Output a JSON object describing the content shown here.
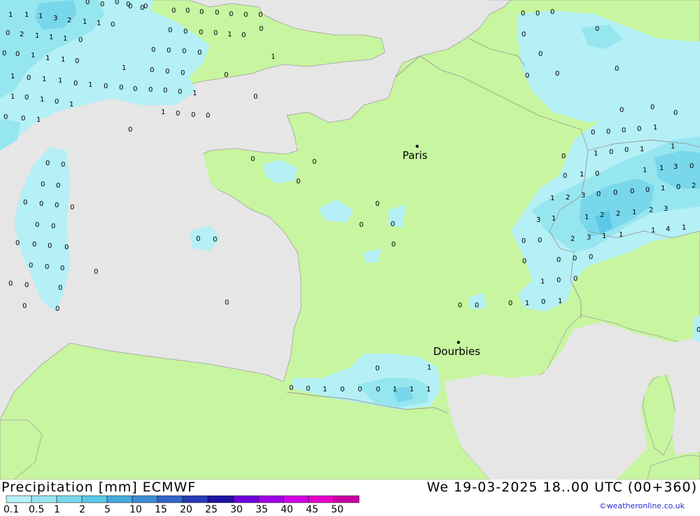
{
  "header": {
    "product": "Precipitation [mm] ECMWF",
    "valid_time": "We 19-03-2025 18..00 UTC (00+360)"
  },
  "credit": "©weatheronline.co.uk",
  "legend": {
    "levels": [
      "0.1",
      "0.5",
      "1",
      "2",
      "5",
      "10",
      "15",
      "20",
      "25",
      "30",
      "35",
      "40",
      "45",
      "50"
    ],
    "colors": [
      "#b4f0f5",
      "#96e6f0",
      "#78d7eb",
      "#5ac8e6",
      "#46aadc",
      "#3c8cd2",
      "#3264c8",
      "#283cb4",
      "#1e14a0",
      "#6e00dc",
      "#a000e6",
      "#d200e6",
      "#e600c8",
      "#c800a0"
    ]
  },
  "cities": [
    {
      "name": "Paris"
    },
    {
      "name": "Dourbies"
    }
  ],
  "colors": {
    "sea": "#e6e6e6",
    "land": "#c8f5a0",
    "precip_light": "#b4f0f5",
    "precip_medium": "#96e6f0",
    "precip_heavy": "#78d7eb",
    "border": "#a0a0a0"
  },
  "precip_values": [
    "1",
    "1",
    "1",
    "3",
    "2",
    "1",
    "1",
    "0",
    "0",
    "0",
    "0",
    "0",
    "0",
    "0",
    "0",
    "0",
    "0",
    "0",
    "0",
    "0",
    "0",
    "0",
    "0",
    "2",
    "1",
    "1",
    "1",
    "0",
    "0",
    "0",
    "0",
    "0",
    "1",
    "0",
    "0",
    "0",
    "0",
    "1",
    "1",
    "1",
    "0",
    "0",
    "0",
    "0",
    "0",
    "1",
    "1",
    "0",
    "1",
    "1",
    "0",
    "1",
    "0",
    "0",
    "0",
    "0",
    "0",
    "0",
    "1",
    "0",
    "1",
    "0",
    "1",
    "0",
    "1",
    "1",
    "0",
    "0",
    "0",
    "0",
    "0",
    "1",
    "1",
    "0",
    "0",
    "0",
    "0",
    "0",
    "0",
    "0",
    "0",
    "0",
    "0",
    "0",
    "0",
    "0",
    "0",
    "0",
    "0",
    "0",
    "0",
    "0",
    "0",
    "0",
    "0",
    "0",
    "0",
    "0",
    "0",
    "0",
    "0",
    "0",
    "0",
    "0",
    "0",
    "0",
    "0",
    "0",
    "0",
    "0",
    "0",
    "0",
    "0",
    "0",
    "0",
    "0",
    "0",
    "0",
    "0",
    "0",
    "0",
    "0",
    "0",
    "0",
    "0",
    "0",
    "0",
    "0",
    "0",
    "0",
    "0",
    "0",
    "0",
    "0",
    "0",
    "0",
    "0",
    "0",
    "0",
    "0",
    "0",
    "0",
    "0",
    "1",
    "0",
    "1",
    "0",
    "0",
    "1",
    "1",
    "0",
    "1",
    "0",
    "1",
    "1",
    "0",
    "1",
    "2",
    "3",
    "0",
    "0",
    "0",
    "0",
    "1",
    "0",
    "2",
    "3",
    "3",
    "1",
    "1",
    "2",
    "2",
    "1",
    "2",
    "3",
    "2",
    "3",
    "1",
    "1",
    "1",
    "4",
    "1",
    "0",
    "0",
    "0",
    "0",
    "0",
    "1",
    "0",
    "0",
    "0",
    "1",
    "1",
    "0",
    "0",
    "1",
    "0",
    "0",
    "0",
    "1",
    "0",
    "0",
    "0",
    "1",
    "1",
    "1",
    "1",
    "2",
    "2",
    "0",
    "0",
    "0"
  ]
}
